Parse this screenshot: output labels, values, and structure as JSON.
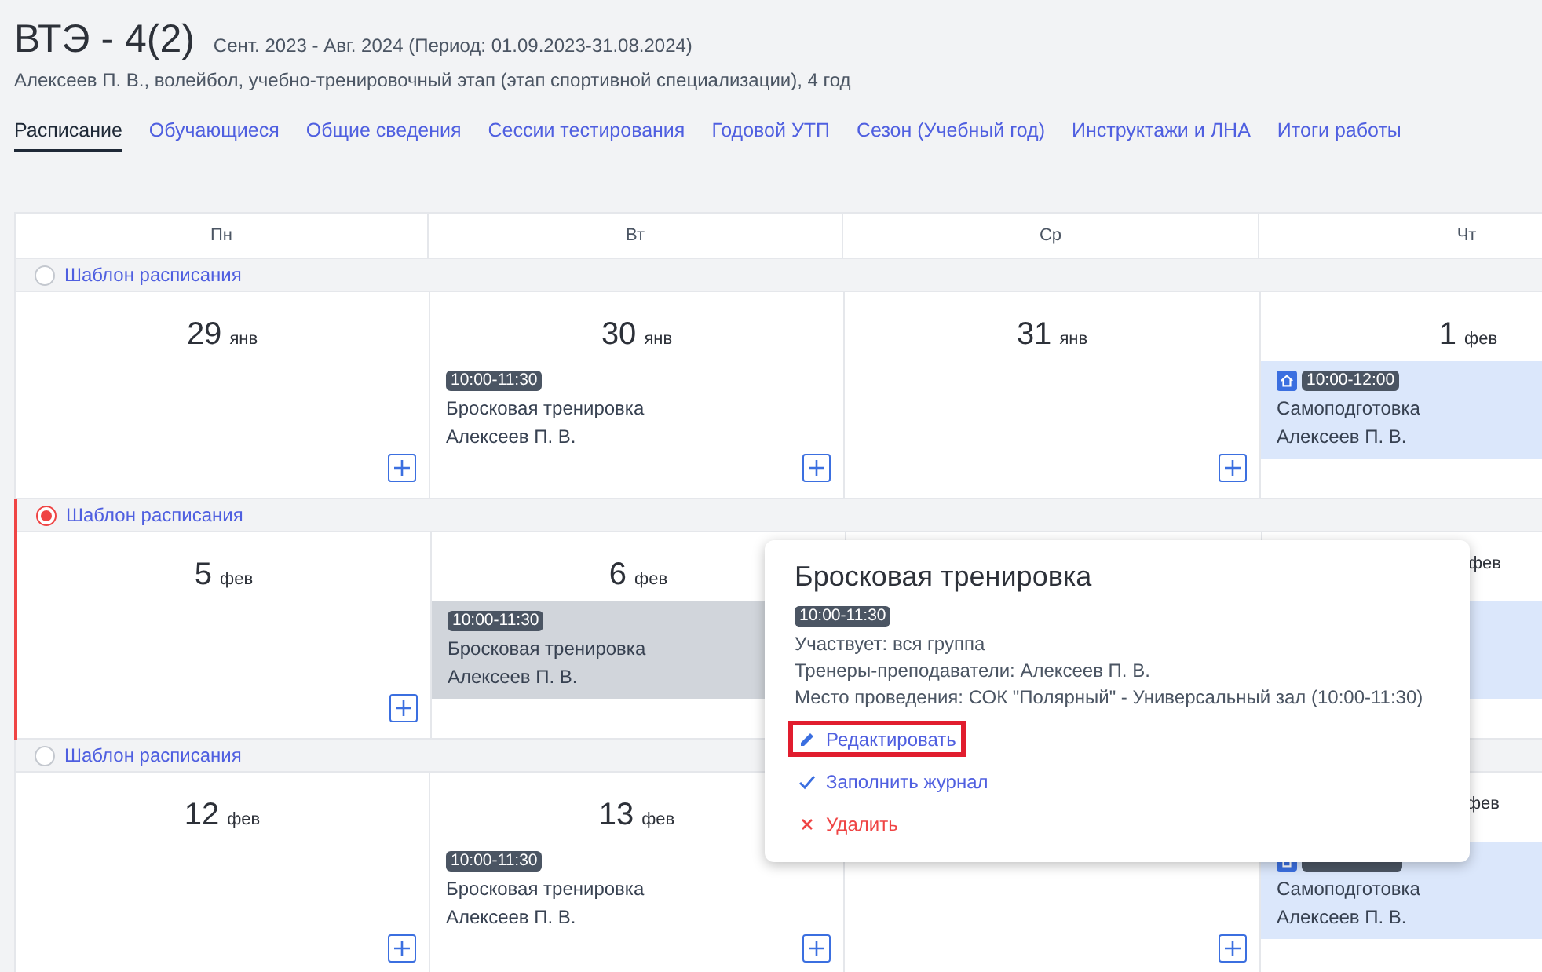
{
  "header": {
    "title": "ВТЭ - 4(2)",
    "period": "Сент. 2023 - Авг. 2024 (Период: 01.09.2023-31.08.2024)",
    "subtitle": "Алексеев П. В., волейбол, учебно-тренировочный этап (этап спортивной специализации), 4 год"
  },
  "tabs": [
    {
      "label": "Расписание",
      "selected": true
    },
    {
      "label": "Обучающиеся",
      "selected": false
    },
    {
      "label": "Общие сведения",
      "selected": false
    },
    {
      "label": "Сессии тестирования",
      "selected": false
    },
    {
      "label": "Годовой УТП",
      "selected": false
    },
    {
      "label": "Сезон (Учебный год)",
      "selected": false
    },
    {
      "label": "Инструктажи и ЛНА",
      "selected": false
    },
    {
      "label": "Итоги работы",
      "selected": false
    }
  ],
  "calendar": {
    "weekdays": [
      "Пн",
      "Вт",
      "Ср",
      "Чт"
    ],
    "weeks": [
      {
        "template_label": "Шаблон расписания",
        "selected": false,
        "days": [
          {
            "day": "29",
            "month": "янв",
            "add_button": true
          },
          {
            "day": "30",
            "month": "янв",
            "add_button": true,
            "events": [
              {
                "kind": "training",
                "selected": false,
                "time": "10:00-11:30",
                "title": "Бросковая тренировка",
                "teacher": "Алексеев П. В."
              }
            ]
          },
          {
            "day": "31",
            "month": "янв",
            "add_button": true
          },
          {
            "day": "1",
            "month": "фев",
            "events": [
              {
                "kind": "self",
                "selected": false,
                "time": "10:00-12:00",
                "title": "Самоподготовка",
                "teacher": "Алексеев П. В."
              }
            ]
          }
        ]
      },
      {
        "template_label": "Шаблон расписания",
        "selected": true,
        "days": [
          {
            "day": "5",
            "month": "фев",
            "add_button": true
          },
          {
            "day": "6",
            "month": "фев",
            "events": [
              {
                "kind": "training",
                "selected": true,
                "time": "10:00-11:30",
                "title": "Бросковая тренировка",
                "teacher": "Алексеев П. В."
              }
            ]
          },
          {
            "kind": "covered"
          },
          {
            "month": "фев",
            "events": [
              {
                "kind": "self",
                "selected": false
              }
            ]
          }
        ]
      },
      {
        "template_label": "Шаблон расписания",
        "selected": false,
        "days": [
          {
            "day": "12",
            "month": "фев",
            "add_button": true
          },
          {
            "day": "13",
            "month": "фев",
            "add_button": true,
            "events": [
              {
                "kind": "training",
                "selected": false,
                "time": "10:00-11:30",
                "title": "Бросковая тренировка",
                "teacher": "Алексеев П. В."
              }
            ]
          },
          {
            "add_button": true
          },
          {
            "month": "фев",
            "events": [
              {
                "kind": "self",
                "selected": false,
                "title": "Самоподготовка",
                "teacher": "Алексеев П. В."
              }
            ]
          }
        ]
      }
    ]
  },
  "popover": {
    "title": "Бросковая тренировка",
    "time": "10:00-11:30",
    "lines": [
      "Участвует: вся группа",
      "Тренеры-преподаватели: Алексеев П. В.",
      "Место проведения: СОК \"Полярный\" - Универсальный зал (10:00-11:30)"
    ],
    "actions": [
      {
        "kind": "edit",
        "label": "Редактировать",
        "highlighted": true
      },
      {
        "kind": "journal",
        "label": "Заполнить журнал",
        "highlighted": false
      },
      {
        "kind": "delete",
        "label": "Удалить",
        "highlighted": false
      }
    ]
  }
}
